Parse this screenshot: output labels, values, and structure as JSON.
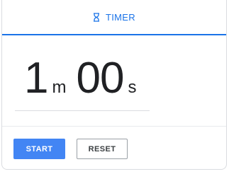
{
  "tab": {
    "icon": "hourglass-icon",
    "label": "TIMER",
    "accent": "#1a73e8"
  },
  "timer": {
    "minutes": "1",
    "minutes_unit": "m",
    "seconds": "00",
    "seconds_unit": "s"
  },
  "buttons": {
    "start_label": "START",
    "reset_label": "RESET",
    "start_color": "#4285f4"
  }
}
